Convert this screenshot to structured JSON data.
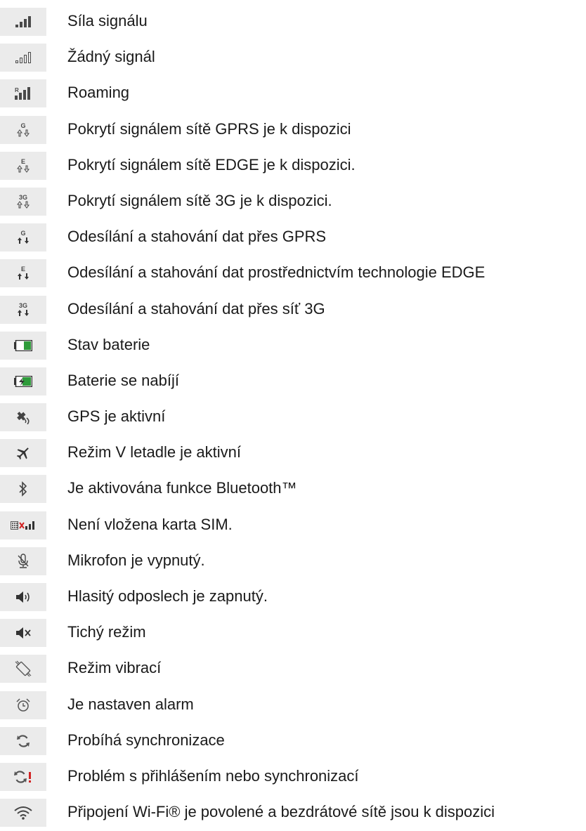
{
  "colors": {
    "icon_bg": "#ebebeb",
    "icon_fg": "#4a4a4a",
    "battery_green": "#2e9b3a",
    "alert_red": "#d22222"
  },
  "legend": [
    {
      "icon": "signal-strength-icon",
      "label": "Síla signálu"
    },
    {
      "icon": "no-signal-icon",
      "label": "Žádný signál"
    },
    {
      "icon": "roaming-icon",
      "label": "Roaming"
    },
    {
      "icon": "gprs-available-icon",
      "label": "Pokrytí signálem sítě GPRS je k dispozici"
    },
    {
      "icon": "edge-available-icon",
      "label": "Pokrytí signálem sítě EDGE je k dispozici."
    },
    {
      "icon": "3g-available-icon",
      "label": "Pokrytí signálem sítě 3G je k dispozici."
    },
    {
      "icon": "gprs-data-transfer-icon",
      "label": "Odesílání a stahování dat přes GPRS"
    },
    {
      "icon": "edge-data-transfer-icon",
      "label": "Odesílání a stahování dat prostřednictvím technologie EDGE"
    },
    {
      "icon": "3g-data-transfer-icon",
      "label": "Odesílání a stahování dat přes síť 3G"
    },
    {
      "icon": "battery-status-icon",
      "label": "Stav baterie"
    },
    {
      "icon": "battery-charging-icon",
      "label": "Baterie se nabíjí"
    },
    {
      "icon": "gps-active-icon",
      "label": "GPS je aktivní"
    },
    {
      "icon": "airplane-mode-icon",
      "label": "Režim V letadle je aktivní"
    },
    {
      "icon": "bluetooth-icon",
      "label": "Je aktivována funkce Bluetooth™"
    },
    {
      "icon": "no-sim-card-icon",
      "label": "Není vložena karta SIM."
    },
    {
      "icon": "microphone-muted-icon",
      "label": "Mikrofon je vypnutý."
    },
    {
      "icon": "speakerphone-on-icon",
      "label": "Hlasitý odposlech je zapnutý."
    },
    {
      "icon": "silent-mode-icon",
      "label": "Tichý režim"
    },
    {
      "icon": "vibrate-mode-icon",
      "label": "Režim vibrací"
    },
    {
      "icon": "alarm-set-icon",
      "label": "Je nastaven alarm"
    },
    {
      "icon": "sync-in-progress-icon",
      "label": "Probíhá synchronizace"
    },
    {
      "icon": "sync-problem-icon",
      "label": "Problém s přihlášením nebo synchronizací"
    },
    {
      "icon": "wifi-available-icon",
      "label": "Připojení Wi-Fi® je povolené a bezdrátové sítě jsou k dispozici"
    }
  ],
  "glyphs": {
    "network_g": "G",
    "network_e": "E",
    "network_3g": "3G",
    "roaming_r": "R"
  }
}
